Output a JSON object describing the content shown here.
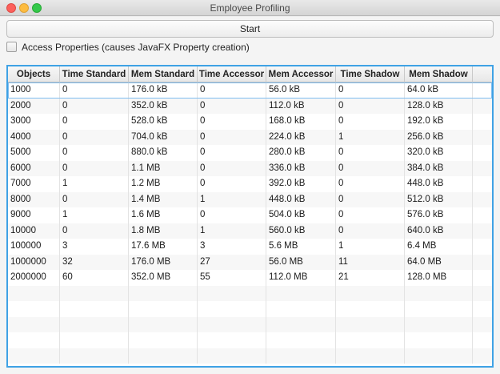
{
  "window": {
    "title": "Employee Profiling"
  },
  "controls": {
    "start_label": "Start",
    "checkbox_label": "Access Properties (causes JavaFX Property creation)",
    "checkbox_checked": false
  },
  "table": {
    "columns": [
      "Objects",
      "Time Standard",
      "Mem Standard",
      "Time Accessor",
      "Mem Accessor",
      "Time Shadow",
      "Mem Shadow"
    ],
    "rows": [
      [
        "1000",
        "0",
        "176.0 kB",
        "0",
        "56.0 kB",
        "0",
        "64.0 kB"
      ],
      [
        "2000",
        "0",
        "352.0 kB",
        "0",
        "112.0 kB",
        "0",
        "128.0 kB"
      ],
      [
        "3000",
        "0",
        "528.0 kB",
        "0",
        "168.0 kB",
        "0",
        "192.0 kB"
      ],
      [
        "4000",
        "0",
        "704.0 kB",
        "0",
        "224.0 kB",
        "1",
        "256.0 kB"
      ],
      [
        "5000",
        "0",
        "880.0 kB",
        "0",
        "280.0 kB",
        "0",
        "320.0 kB"
      ],
      [
        "6000",
        "0",
        "1.1 MB",
        "0",
        "336.0 kB",
        "0",
        "384.0 kB"
      ],
      [
        "7000",
        "1",
        "1.2 MB",
        "0",
        "392.0 kB",
        "0",
        "448.0 kB"
      ],
      [
        "8000",
        "0",
        "1.4 MB",
        "1",
        "448.0 kB",
        "0",
        "512.0 kB"
      ],
      [
        "9000",
        "1",
        "1.6 MB",
        "0",
        "504.0 kB",
        "0",
        "576.0 kB"
      ],
      [
        "10000",
        "0",
        "1.8 MB",
        "1",
        "560.0 kB",
        "0",
        "640.0 kB"
      ],
      [
        "100000",
        "3",
        "17.6 MB",
        "3",
        "5.6 MB",
        "1",
        "6.4 MB"
      ],
      [
        "1000000",
        "32",
        "176.0 MB",
        "27",
        "56.0 MB",
        "11",
        "64.0 MB"
      ],
      [
        "2000000",
        "60",
        "352.0 MB",
        "55",
        "112.0 MB",
        "21",
        "128.0 MB"
      ]
    ],
    "empty_rows": 5,
    "selected_row": 0
  },
  "colors": {
    "focus_border": "#3fa2e5",
    "close": "#fc605c",
    "minimize": "#fdbc40",
    "maximize": "#34c84a"
  }
}
